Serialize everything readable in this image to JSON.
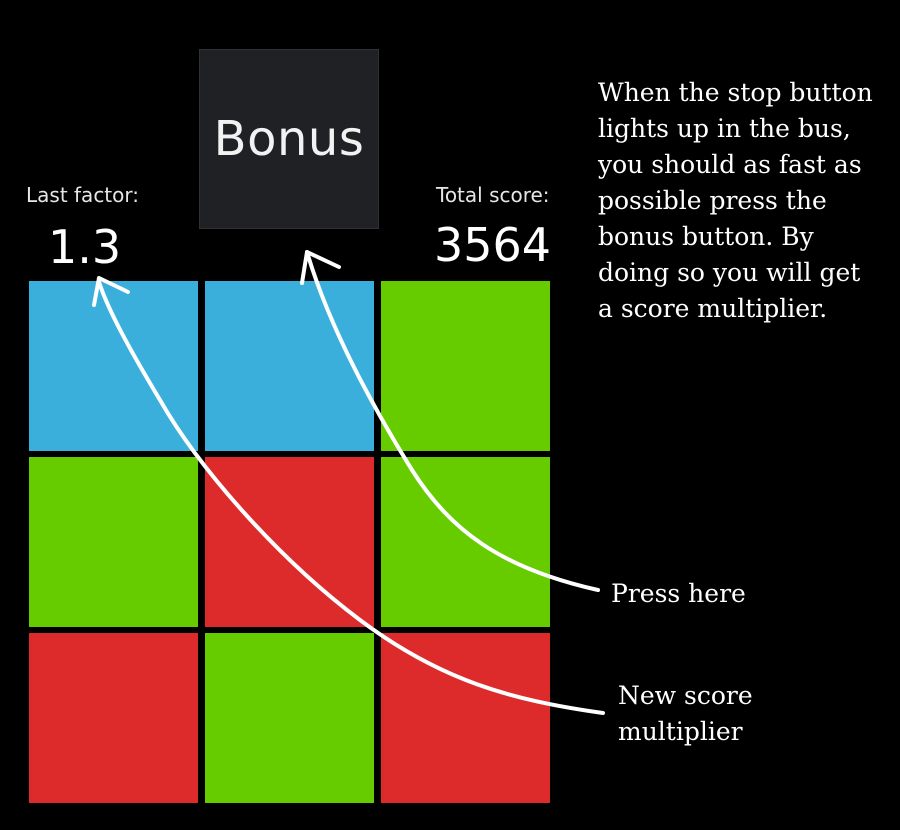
{
  "stats": {
    "last_factor_label": "Last factor:",
    "last_factor_value": "1.3",
    "total_score_label": "Total score:",
    "total_score_value": "3564"
  },
  "bonus": {
    "label": "Bonus"
  },
  "grid": {
    "tiles": [
      {
        "color_name": "blue",
        "color": "#3AAFDC"
      },
      {
        "color_name": "blue",
        "color": "#3AAFDC"
      },
      {
        "color_name": "green",
        "color": "#66CC00"
      },
      {
        "color_name": "green",
        "color": "#66CC00"
      },
      {
        "color_name": "red",
        "color": "#DD2B2B"
      },
      {
        "color_name": "green",
        "color": "#66CC00"
      },
      {
        "color_name": "red",
        "color": "#DD2B2B"
      },
      {
        "color_name": "green",
        "color": "#66CC00"
      },
      {
        "color_name": "red",
        "color": "#DD2B2B"
      }
    ]
  },
  "annotations": {
    "instructions": "When the stop button lights up in the bus, you should as fast as possible press the bonus button. By doing so you will get a score multiplier.",
    "press_here": "Press here",
    "new_multiplier": "New score multiplier"
  },
  "colors": {
    "background": "#000000",
    "button_bg": "#202124",
    "text": "#FFFFFF",
    "annotation_stroke": "#FFFFFF"
  }
}
